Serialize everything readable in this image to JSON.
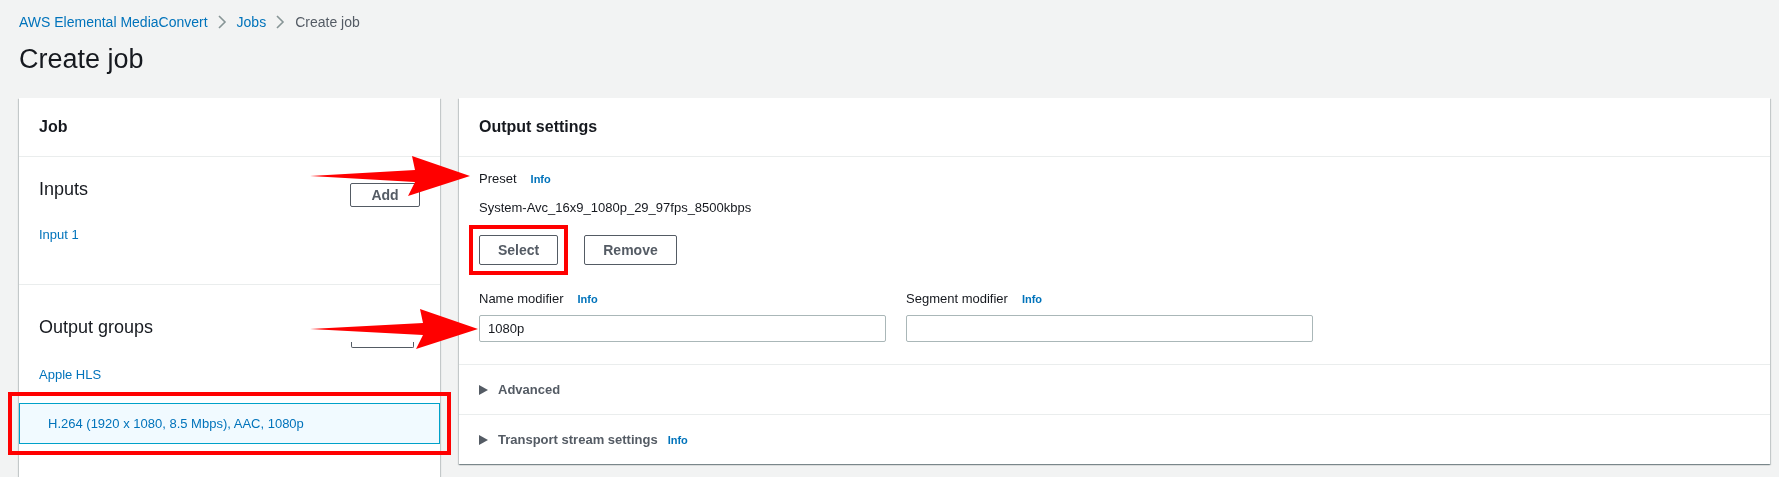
{
  "breadcrumbs": [
    {
      "label": "AWS Elemental MediaConvert",
      "link": true
    },
    {
      "label": "Jobs",
      "link": true
    },
    {
      "label": "Create job",
      "link": false
    }
  ],
  "page_title": "Create job",
  "job_panel": {
    "title": "Job",
    "sections": [
      {
        "title": "Inputs",
        "button": "Add",
        "arrow": false,
        "items": [
          {
            "label": "Input 1",
            "selected": false,
            "highlighted": false
          }
        ]
      },
      {
        "title": "Output groups",
        "arrow": false,
        "items": [
          {
            "label": "Apple HLS",
            "selected": false,
            "highlighted": false
          },
          {
            "label": "H.264 (1920 x 1080, 8.5 Mbps), AAC, 1080p",
            "selected": true,
            "highlighted": true
          }
        ]
      }
    ]
  },
  "output_settings": {
    "title": "Output settings",
    "preset": {
      "label": "Preset",
      "info": "Info",
      "value": "System-Avc_16x9_1080p_29_97fps_8500kbps",
      "arrow": true,
      "buttons": [
        {
          "label": "Select",
          "highlighted": true
        },
        {
          "label": "Remove",
          "highlighted": false
        }
      ]
    },
    "fields": [
      {
        "label": "Name modifier",
        "info": "Info",
        "value": "1080p",
        "arrow": true
      },
      {
        "label": "Segment modifier",
        "info": "Info",
        "arrow": false
      }
    ],
    "expanders": [
      {
        "label": "Advanced",
        "expanded": false
      },
      {
        "label": "Transport stream settings",
        "info": "Info",
        "expanded": false
      }
    ]
  }
}
